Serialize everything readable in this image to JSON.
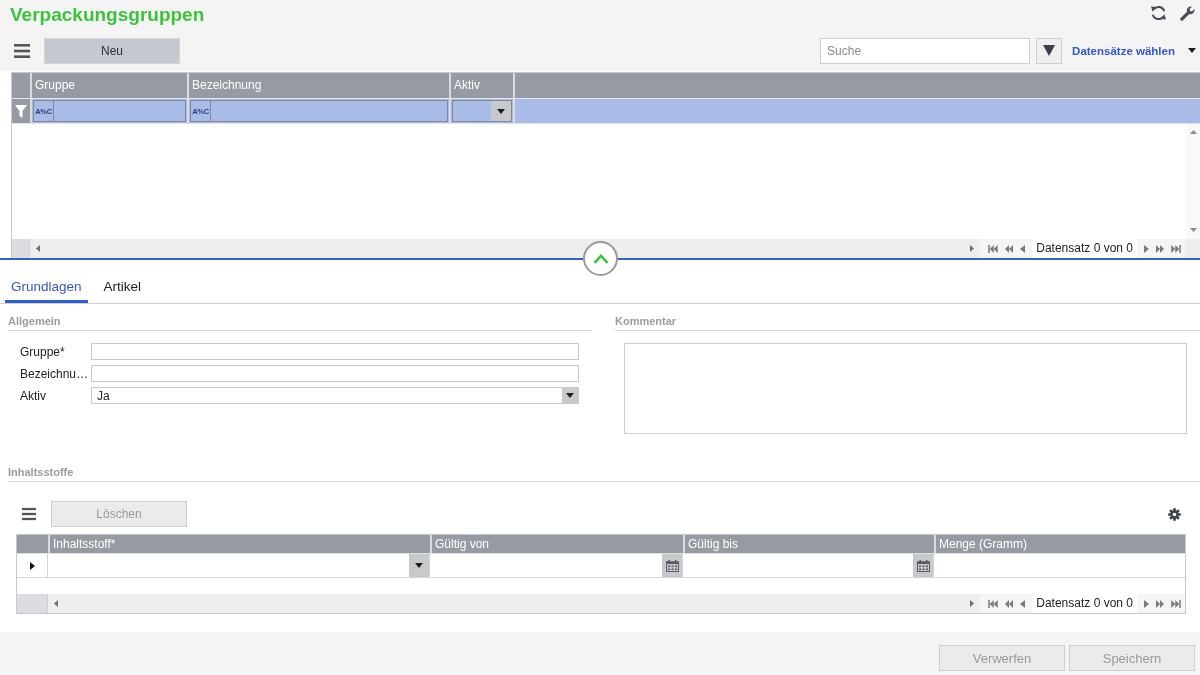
{
  "page": {
    "title": "Verpackungsgruppen"
  },
  "toolbar": {
    "buttons": [
      {
        "label": "Neu",
        "disabled": false
      }
    ],
    "search": {
      "placeholder": "Suche"
    },
    "record_menu": "Datensätze wählen"
  },
  "grid": {
    "columns": [
      {
        "label": "Gruppe",
        "filter": {
          "kind": "text",
          "operator": "A%C"
        }
      },
      {
        "label": "Bezeichnung",
        "filter": {
          "kind": "text",
          "operator": "A%C"
        }
      },
      {
        "label": "Aktiv",
        "filter": {
          "kind": "dropdown"
        }
      }
    ],
    "pager": "Datensatz 0 von 0"
  },
  "splitter": {
    "expanded": true
  },
  "tabs": [
    {
      "label": "Grundlagen",
      "selected": true
    },
    {
      "label": "Artikel",
      "selected": false
    }
  ],
  "general": {
    "title": "Allgemein",
    "fields": [
      {
        "label": "Gruppe*",
        "kind": "text"
      },
      {
        "label": "Bezeichnu…",
        "kind": "text"
      },
      {
        "label": "Aktiv",
        "kind": "select",
        "value": "Ja"
      }
    ]
  },
  "comment": {
    "title": "Kommentar"
  },
  "ingredients": {
    "title": "Inhaltsstoffe",
    "buttons": [
      {
        "label": "Löschen",
        "disabled": true
      }
    ],
    "columns": [
      {
        "label": "Inhaltsstoff*",
        "kind": "dropdown"
      },
      {
        "label": "Gültig von",
        "kind": "date"
      },
      {
        "label": "Gültig bis",
        "kind": "date"
      },
      {
        "label": "Menge (Gramm)",
        "kind": "text"
      }
    ],
    "rows": [
      {
        "current": true
      }
    ],
    "pager": "Datensatz 0 von 0"
  },
  "footer": {
    "buttons": [
      {
        "label": "Verwerfen",
        "disabled": true
      },
      {
        "label": "Speichern",
        "disabled": true
      }
    ]
  }
}
